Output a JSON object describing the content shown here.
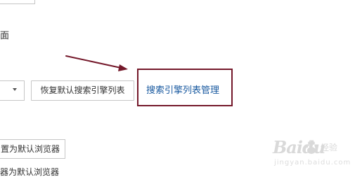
{
  "settings": {
    "section_heading_partial": "面",
    "restore_default_button": "恢复默认搜索引擎列表",
    "manage_search_engines_link": "搜索引擎列表管理",
    "set_default_browser_button": "置为默认浏览器",
    "default_browser_status": "器为默认浏览器"
  },
  "annotation": {
    "highlight_color": "#74182a",
    "arrow_color": "#74182a"
  },
  "watermark": {
    "logo": "Baidu",
    "label": "经验",
    "domain": "jingyan.baidu.com"
  },
  "colors": {
    "link": "#1a5aa0",
    "border": "#c6c6c6",
    "text": "#333333"
  }
}
